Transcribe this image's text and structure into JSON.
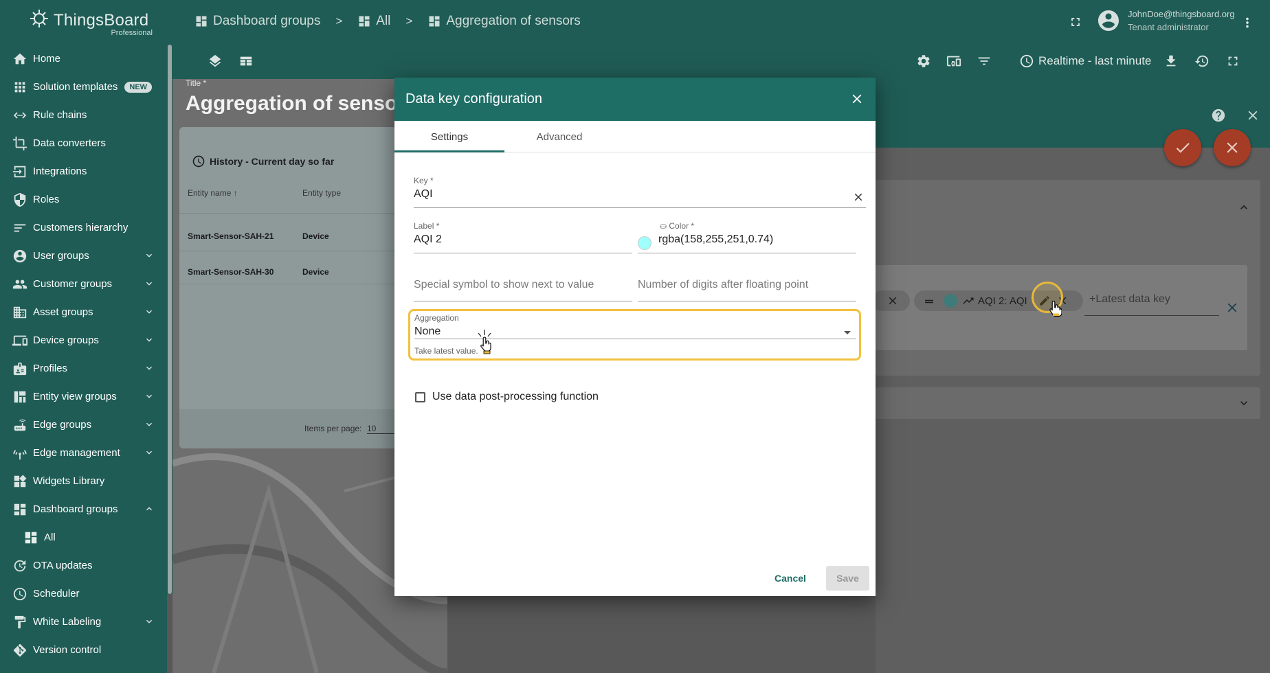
{
  "app": {
    "brand": "ThingsBoard",
    "edition": "Professional"
  },
  "breadcrumb": [
    {
      "label": "Dashboard groups",
      "icon": "dashboard-icon"
    },
    {
      "label": "All",
      "icon": "dashboard-icon"
    },
    {
      "label": "Aggregation of sensors",
      "icon": "dashboard-icon"
    }
  ],
  "breadcrumb_separator": ">",
  "user": {
    "email": "JohnDoe@thingsboard.org",
    "role": "Tenant administrator"
  },
  "sidebar": {
    "items": [
      {
        "label": "Home",
        "icon": "home-icon"
      },
      {
        "label": "Solution templates",
        "icon": "apps-icon",
        "badge": "NEW"
      },
      {
        "label": "Rule chains",
        "icon": "rule-chain-icon"
      },
      {
        "label": "Data converters",
        "icon": "converter-icon"
      },
      {
        "label": "Integrations",
        "icon": "integration-icon"
      },
      {
        "label": "Roles",
        "icon": "shield-icon"
      },
      {
        "label": "Customers hierarchy",
        "icon": "hierarchy-icon"
      },
      {
        "label": "User groups",
        "icon": "account-icon",
        "expandable": true
      },
      {
        "label": "Customer groups",
        "icon": "people-icon",
        "expandable": true
      },
      {
        "label": "Asset groups",
        "icon": "domain-icon",
        "expandable": true
      },
      {
        "label": "Device groups",
        "icon": "devices-icon",
        "expandable": true
      },
      {
        "label": "Profiles",
        "icon": "badge-icon",
        "expandable": true
      },
      {
        "label": "Entity view groups",
        "icon": "view-quilt-icon",
        "expandable": true
      },
      {
        "label": "Edge groups",
        "icon": "router-icon",
        "expandable": true
      },
      {
        "label": "Edge management",
        "icon": "antenna-icon",
        "expandable": true
      },
      {
        "label": "Widgets Library",
        "icon": "widgets-icon"
      },
      {
        "label": "Dashboard groups",
        "icon": "dashboard-icon",
        "expanded": true
      },
      {
        "label": "All",
        "icon": "dashboard-icon",
        "sub": true
      },
      {
        "label": "OTA updates",
        "icon": "update-icon"
      },
      {
        "label": "Scheduler",
        "icon": "clock-icon"
      },
      {
        "label": "White Labeling",
        "icon": "paint-roller-icon",
        "expandable": true
      },
      {
        "label": "Version control",
        "icon": "git-icon"
      }
    ]
  },
  "toolbar": {
    "timewindow": "Realtime - last minute"
  },
  "dashboard": {
    "title_label": "Title *",
    "title": "Aggregation of sensors",
    "widget": {
      "header": "History - Current day so far",
      "columns": [
        "Entity name",
        "Entity type"
      ],
      "rows": [
        [
          "Smart-Sensor-SAH-21",
          "Device"
        ],
        [
          "Smart-Sensor-SAH-30",
          "Device"
        ]
      ],
      "items_per_page_label": "Items per page:",
      "items_per_page": "10"
    },
    "datakey_chip": "AQI 2: AQI",
    "latest_key_placeholder": "+Latest data key"
  },
  "dialog": {
    "title": "Data key configuration",
    "tabs": [
      "Settings",
      "Advanced"
    ],
    "active_tab": "Settings",
    "key": {
      "label": "Key *",
      "value": "AQI"
    },
    "label": {
      "label": "Label *",
      "value": "AQI 2"
    },
    "color": {
      "label": "Color *",
      "value": "rgba(158,255,251,0.74)",
      "swatch": "#9efffb"
    },
    "special_symbol": {
      "placeholder": "Special symbol to show next to value"
    },
    "decimals": {
      "placeholder": "Number of digits after floating point"
    },
    "aggregation": {
      "label": "Aggregation",
      "value": "None",
      "hint": "Take latest value."
    },
    "post_processing": {
      "label": "Use data post-processing function",
      "checked": false
    },
    "cancel": "Cancel",
    "save": "Save"
  },
  "colors": {
    "primary": "#1f5c55",
    "dialog_header": "#1f6e66",
    "highlight": "#f3c13e",
    "fab": "#a43c26"
  }
}
